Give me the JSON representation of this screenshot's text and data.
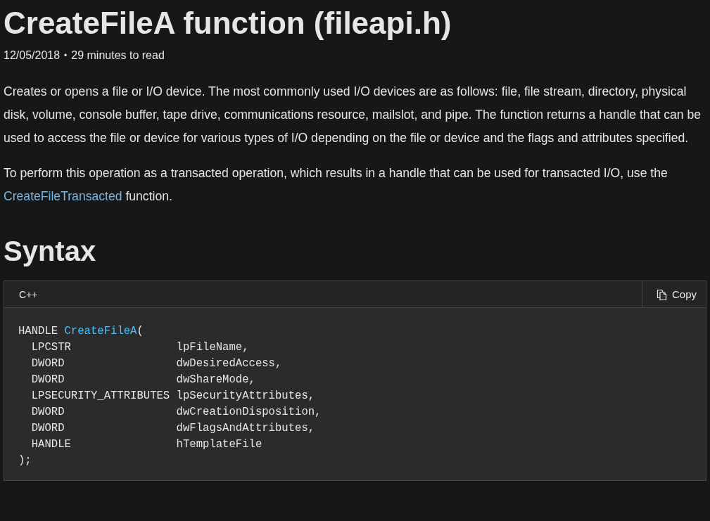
{
  "title": "CreateFileA function (fileapi.h)",
  "meta": {
    "date": "12/05/2018",
    "separator": "•",
    "read_time": "29 minutes to read"
  },
  "paragraphs": [
    {
      "parts": [
        {
          "kind": "text",
          "text": "Creates or opens a file or I/O device. The most commonly used I/O devices are as follows: file, file stream, directory, physical disk, volume, console buffer, tape drive, communications resource, mailslot, and pipe. The function returns a handle that can be used to access the file or device for various types of I/O depending on the file or device and the flags and attributes specified."
        }
      ]
    },
    {
      "parts": [
        {
          "kind": "text",
          "text": "To perform this operation as a transacted operation, which results in a handle that can be used for transacted I/O, use the "
        },
        {
          "kind": "link",
          "text": "CreateFileTransacted"
        },
        {
          "kind": "text",
          "text": " function."
        }
      ]
    }
  ],
  "section_heading": "Syntax",
  "code_block": {
    "language": "C++",
    "copy_label": "Copy",
    "lines": [
      {
        "parts": [
          {
            "kind": "plain",
            "text": "HANDLE "
          },
          {
            "kind": "function",
            "text": "CreateFileA"
          },
          {
            "kind": "plain",
            "text": "("
          }
        ]
      },
      {
        "parts": [
          {
            "kind": "plain",
            "text": "  LPCSTR                lpFileName,"
          }
        ]
      },
      {
        "parts": [
          {
            "kind": "plain",
            "text": "  DWORD                 dwDesiredAccess,"
          }
        ]
      },
      {
        "parts": [
          {
            "kind": "plain",
            "text": "  DWORD                 dwShareMode,"
          }
        ]
      },
      {
        "parts": [
          {
            "kind": "plain",
            "text": "  LPSECURITY_ATTRIBUTES lpSecurityAttributes,"
          }
        ]
      },
      {
        "parts": [
          {
            "kind": "plain",
            "text": "  DWORD                 dwCreationDisposition,"
          }
        ]
      },
      {
        "parts": [
          {
            "kind": "plain",
            "text": "  DWORD                 dwFlagsAndAttributes,"
          }
        ]
      },
      {
        "parts": [
          {
            "kind": "plain",
            "text": "  HANDLE                hTemplateFile"
          }
        ]
      },
      {
        "parts": [
          {
            "kind": "plain",
            "text": ");"
          }
        ]
      }
    ]
  }
}
